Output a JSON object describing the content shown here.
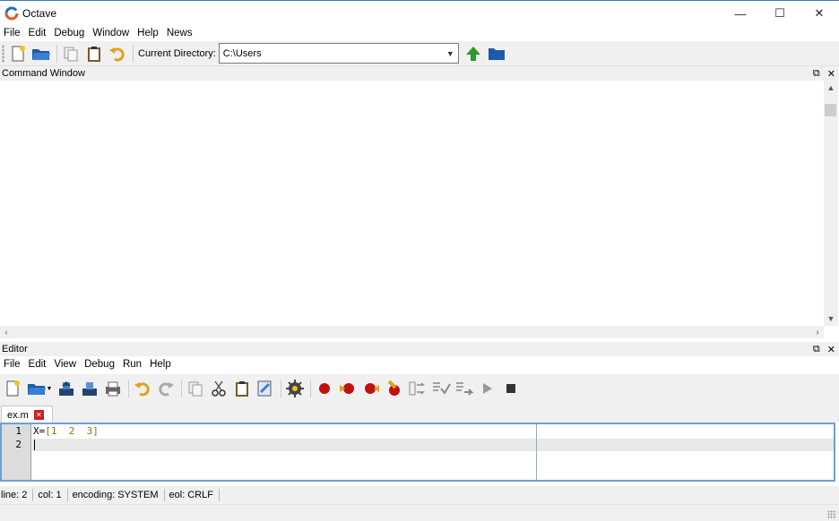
{
  "window": {
    "title": "Octave",
    "controls": {
      "minimize": "—",
      "maximize": "☐",
      "close": "✕"
    }
  },
  "main_menu": [
    "File",
    "Edit",
    "Debug",
    "Window",
    "Help",
    "News"
  ],
  "main_toolbar": {
    "icons": [
      "new-script-icon",
      "open-folder-icon",
      "copy-icon",
      "paste-icon",
      "undo-icon"
    ],
    "current_dir_label": "Current Directory:",
    "current_dir_value": "C:\\Users",
    "nav_icons": [
      "go-up-icon",
      "browse-folder-icon"
    ]
  },
  "command_window": {
    "title": "Command Window",
    "float_icon": "⧉",
    "close_icon": "✕"
  },
  "editor": {
    "title": "Editor",
    "float_icon": "⧉",
    "close_icon": "✕",
    "menu": [
      "File",
      "Edit",
      "View",
      "Debug",
      "Run",
      "Help"
    ],
    "tab": {
      "label": "ex.m",
      "close": "✕"
    },
    "lines": [
      {
        "num": "1",
        "code": {
          "ident": "X",
          "op": "=",
          "open": "[",
          "nums": "1  2  3",
          "close": "]"
        }
      },
      {
        "num": "2",
        "code": ""
      }
    ]
  },
  "status_bar": {
    "line_label": "line:",
    "line_value": "2",
    "col_label": "col:",
    "col_value": "1",
    "encoding_label": "encoding:",
    "encoding_value": "SYSTEM",
    "eol_label": "eol:",
    "eol_value": "CRLF"
  },
  "colors": {
    "title_accent": "#3c7fb1",
    "editor_focus": "#6e9fd8",
    "breakpoint": "#c01010",
    "folder": "#1d5aa8",
    "up_arrow": "#2a9a2a"
  }
}
